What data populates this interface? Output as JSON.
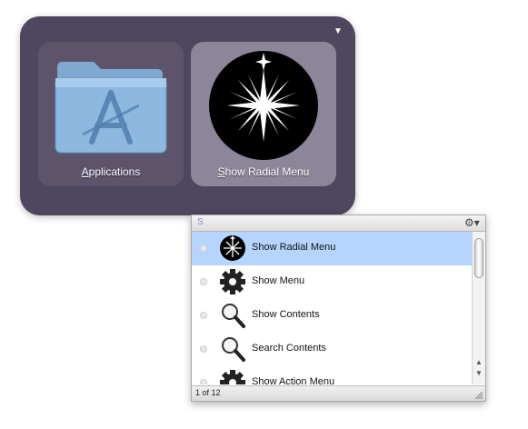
{
  "panel": {
    "menu_icon": "triangle-down-icon",
    "left_pane": {
      "label_first": "A",
      "label_rest": "pplications",
      "icon": "applications-folder-icon"
    },
    "right_pane": {
      "label_first": "S",
      "label_rest": "how Radial Menu",
      "icon": "radial-star-icon"
    }
  },
  "list": {
    "query": "S",
    "gear_icon": "gear-icon",
    "items": [
      {
        "label": "Show Radial Menu",
        "icon": "radial-star-icon",
        "selected": true
      },
      {
        "label": "Show Menu",
        "icon": "gear-icon"
      },
      {
        "label": "Show Contents",
        "icon": "magnifier-icon"
      },
      {
        "label": "Search Contents",
        "icon": "magnifier-icon"
      },
      {
        "label": "Show Action Menu",
        "icon": "gear-icon"
      }
    ],
    "count": "1 of 12"
  },
  "colors": {
    "panel_bg": "#4f4660",
    "selected_row": "#b5d5ff",
    "query_text": "#8e86c7"
  }
}
